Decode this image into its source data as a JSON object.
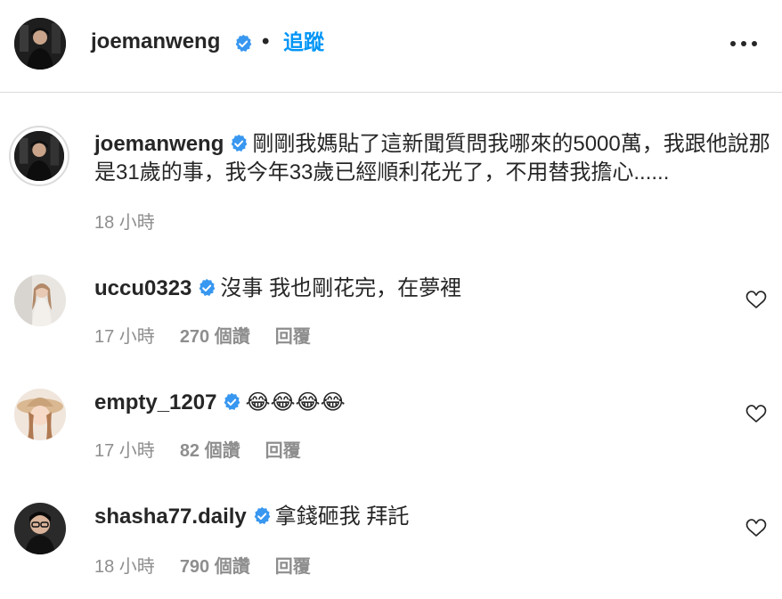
{
  "header": {
    "username": "joemanweng",
    "separator": "•",
    "follow_label": "追蹤"
  },
  "caption": {
    "username": "joemanweng",
    "text": "剛剛我媽貼了這新聞質問我哪來的5000萬，我跟他說那是31歲的事，我今年33歲已經順利花光了，不用替我擔心......",
    "time": "18 小時"
  },
  "comments": [
    {
      "username": "uccu0323",
      "text": "沒事 我也剛花完，在夢裡",
      "time": "17 小時",
      "likes": "270 個讚",
      "reply_label": "回覆"
    },
    {
      "username": "empty_1207",
      "text": "😂😂😂😂",
      "time": "17 小時",
      "likes": "82 個讚",
      "reply_label": "回覆"
    },
    {
      "username": "shasha77.daily",
      "text": "拿錢砸我 拜託",
      "time": "18 小時",
      "likes": "790 個讚",
      "reply_label": "回覆"
    }
  ],
  "colors": {
    "accent": "#0095f6",
    "verified": "#3897f0",
    "muted": "#8e8e8e",
    "text": "#262626"
  },
  "icons": {
    "verified": "verified-badge-icon",
    "more": "more-options-icon",
    "like": "heart-icon"
  }
}
